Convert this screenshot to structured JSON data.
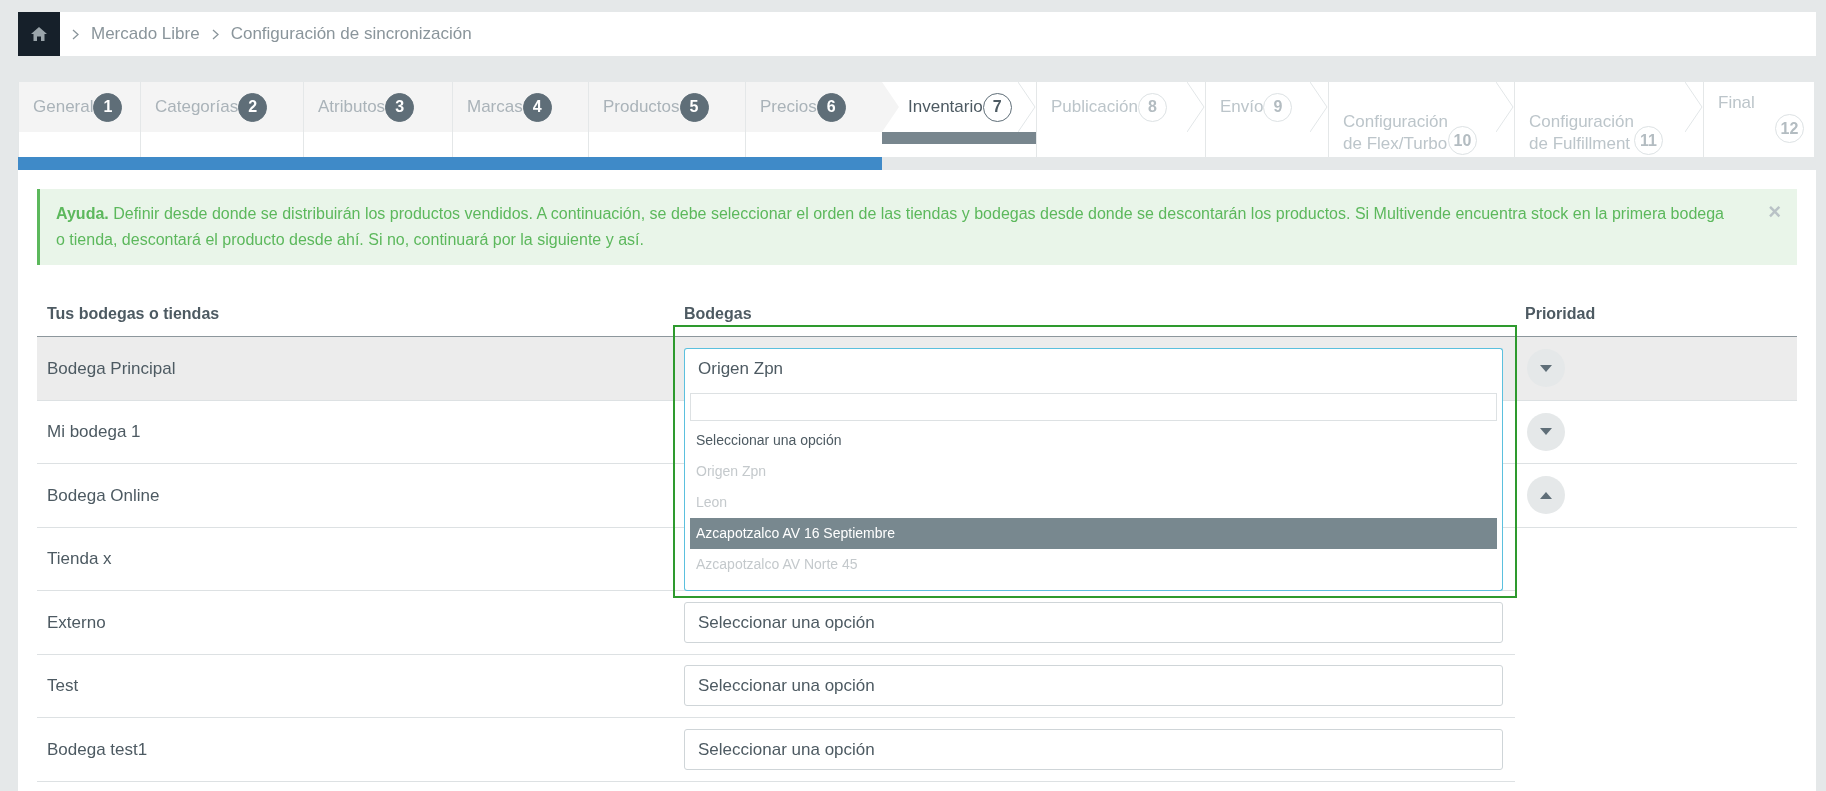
{
  "breadcrumb": [
    {
      "label": "Mercado Libre"
    },
    {
      "label": "Configuración de sincronización"
    }
  ],
  "steps": [
    {
      "label": "General",
      "number": "1",
      "completed": true,
      "selected": false
    },
    {
      "label": "Categorías",
      "number": "2",
      "completed": true,
      "selected": false
    },
    {
      "label": "Atributos",
      "number": "3",
      "completed": true,
      "selected": false
    },
    {
      "label": "Marcas",
      "number": "4",
      "completed": true,
      "selected": false
    },
    {
      "label": "Productos",
      "number": "5",
      "completed": true,
      "selected": false
    },
    {
      "label": "Precios",
      "number": "6",
      "completed": true,
      "selected": false
    },
    {
      "label": "Inventario",
      "number": "7",
      "completed": false,
      "selected": true
    },
    {
      "label": "Publicación",
      "number": "8",
      "completed": false,
      "selected": false
    },
    {
      "label": "Envío",
      "number": "9",
      "completed": false,
      "selected": false
    },
    {
      "label": "Configuración\nde Flex/Turbo",
      "number": "10",
      "completed": false,
      "selected": false
    },
    {
      "label": "Configuración\nde Fulfillment",
      "number": "11",
      "completed": false,
      "selected": false
    },
    {
      "label": "Final",
      "number": "12",
      "completed": false,
      "selected": false
    }
  ],
  "alert": {
    "text": "**Ayuda.** Definir desde donde se distribuirán los productos vendidos. A continuación, se debe seleccionar el orden de las tiendas y bodegas desde donde se descontarán los productos. Si Multivende encuentra stock en la primera bodega o tienda, descontará el producto desde ahí. Si no, continuará por la siguiente y así.",
    "close": "×"
  },
  "table": {
    "columns": [
      "Tus bodegas o tiendas",
      "Bodegas",
      "Prioridad"
    ],
    "rows": [
      {
        "name": "Bodega Principal",
        "select": "Origen Zpn",
        "kind": "down",
        "selected": true
      },
      {
        "name": "Mi bodega 1",
        "kind": "down",
        "selected": false
      },
      {
        "name": "Bodega Online",
        "kind": "up",
        "selected": false
      },
      {
        "name": "Tienda x",
        "selected": false
      },
      {
        "name": "Externo",
        "select": "Seleccionar una opción",
        "selected": false
      },
      {
        "name": "Test",
        "select": "Seleccionar una opción",
        "selected": false
      },
      {
        "name": "Bodega test1",
        "select": "Seleccionar una opción",
        "selected": false
      }
    ]
  },
  "dropdown": {
    "options": [
      {
        "label": "Seleccionar una opción",
        "disabled": false,
        "highlighted": false
      },
      {
        "label": "Origen Zpn",
        "disabled": true,
        "highlighted": false
      },
      {
        "label": "Leon",
        "disabled": true,
        "highlighted": false
      },
      {
        "label": "Azcapotzalco AV 16 Septiembre",
        "disabled": false,
        "highlighted": true
      },
      {
        "label": "Azcapotzalco AV Norte 45",
        "disabled": true,
        "highlighted": false
      }
    ]
  }
}
